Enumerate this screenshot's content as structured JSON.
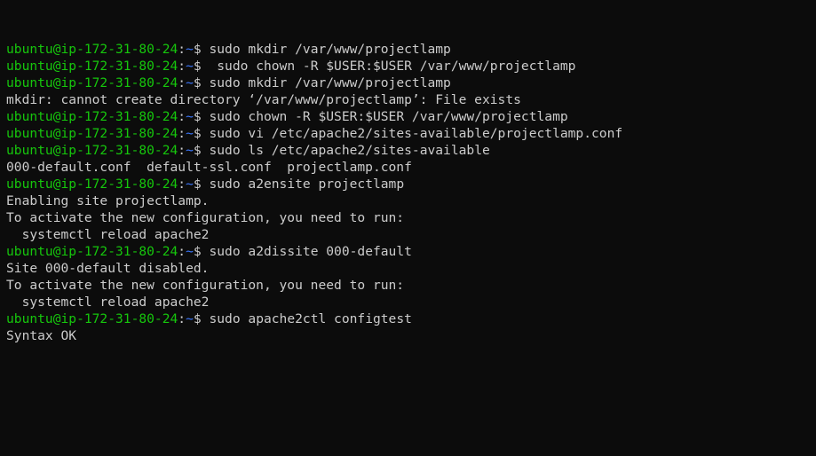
{
  "colors": {
    "background": "#0c0c0c",
    "text": "#cccccc",
    "prompt_user_host": "#16c60c",
    "prompt_path": "#3b78ff",
    "cursor": "#ffffff"
  },
  "prompt": {
    "user_host": "ubuntu@ip-172-31-80-24",
    "colon": ":",
    "path": "~",
    "dollar": "$"
  },
  "lines": [
    {
      "kind": "cmd",
      "text": " sudo mkdir /var/www/projectlamp"
    },
    {
      "kind": "cmd",
      "text": "  sudo chown -R $USER:$USER /var/www/projectlamp"
    },
    {
      "kind": "cmd",
      "text": " sudo mkdir /var/www/projectlamp"
    },
    {
      "kind": "out",
      "text": "mkdir: cannot create directory ‘/var/www/projectlamp’: File exists"
    },
    {
      "kind": "cmd",
      "text": " sudo chown -R $USER:$USER /var/www/projectlamp"
    },
    {
      "kind": "cmd",
      "text": " sudo vi /etc/apache2/sites-available/projectlamp.conf"
    },
    {
      "kind": "cmd",
      "text": " sudo ls /etc/apache2/sites-available"
    },
    {
      "kind": "out",
      "text": "000-default.conf  default-ssl.conf  projectlamp.conf"
    },
    {
      "kind": "cmd",
      "text": " sudo a2ensite projectlamp"
    },
    {
      "kind": "out",
      "text": "Enabling site projectlamp."
    },
    {
      "kind": "out",
      "text": "To activate the new configuration, you need to run:"
    },
    {
      "kind": "out",
      "text": "  systemctl reload apache2"
    },
    {
      "kind": "cmd",
      "text": " sudo a2dissite 000-default"
    },
    {
      "kind": "out",
      "text": "Site 000-default disabled."
    },
    {
      "kind": "out",
      "text": "To activate the new configuration, you need to run:"
    },
    {
      "kind": "out",
      "text": "  systemctl reload apache2"
    },
    {
      "kind": "cmd",
      "text": " sudo apache2ctl configtest"
    },
    {
      "kind": "out",
      "text": "Syntax OK"
    }
  ]
}
